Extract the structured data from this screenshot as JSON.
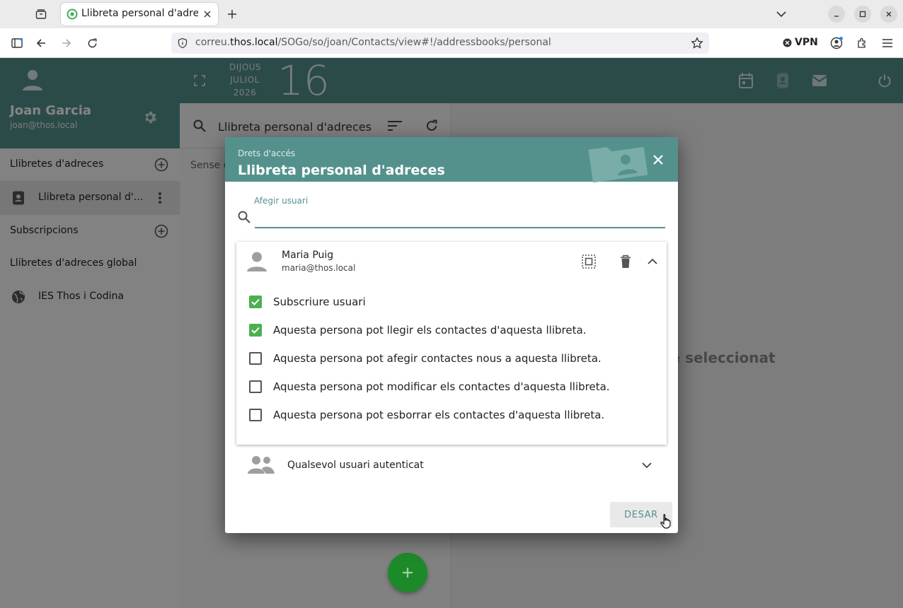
{
  "browser": {
    "tab_title": "Llibreta personal d'adreces",
    "url_prefix": "correu.",
    "url_domain": "thos.local",
    "url_path": "/SOGo/so/joan/Contacts/view#!/addressbooks/personal",
    "vpn_label": "VPN"
  },
  "sidebar": {
    "user_name": "Joan Garcia",
    "user_email": "joan@thos.local",
    "sections": {
      "addressbooks": "Llibretes d'adreces",
      "personal_book": "Llibreta personal d'...",
      "subscriptions": "Subscripcions",
      "global": "Llibretes d'adreces global",
      "global_book": "IES Thos i Codina"
    }
  },
  "topbar": {
    "weekday": "DIJOUS",
    "month": "JULIOL",
    "year": "2026",
    "day": "16"
  },
  "list": {
    "search_label": "Llibreta personal d'adreces",
    "empty_text": "Sense c"
  },
  "detail": {
    "no_selection": "te seleccionat"
  },
  "dialog": {
    "subtitle": "Drets d'accés",
    "title": "Llibreta personal d'adreces",
    "add_user_label": "Afegir usuari",
    "add_user_value": "",
    "user": {
      "name": "Maria Puig",
      "email": "maria@thos.local"
    },
    "permissions": [
      {
        "label": "Subscriure usuari",
        "checked": true
      },
      {
        "label": "Aquesta persona pot llegir els contactes d'aquesta llibreta.",
        "checked": true
      },
      {
        "label": "Aquesta persona pot afegir contactes nous a aquesta llibreta.",
        "checked": false
      },
      {
        "label": "Aquesta persona pot modificar els contactes d'aquesta llibreta.",
        "checked": false
      },
      {
        "label": "Aquesta persona pot esborrar els contactes d'aquesta llibreta.",
        "checked": false
      }
    ],
    "any_user_label": "Qualsevol usuari autenticat",
    "save_label": "DESAR"
  },
  "colors": {
    "accent": "#54918d",
    "check": "#4caf50",
    "fab": "#1d8a2a"
  }
}
